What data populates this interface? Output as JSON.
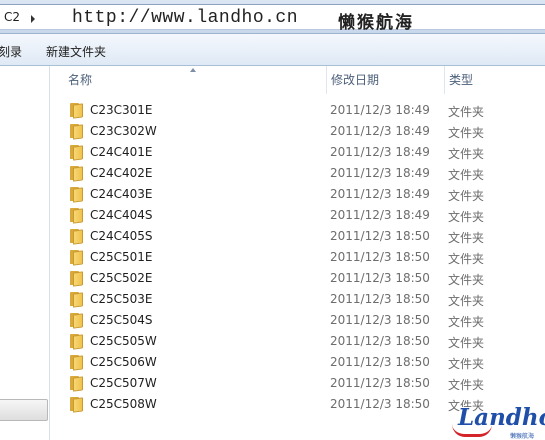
{
  "address": {
    "crumb": "C2",
    "watermark_url": "http://www.landho.cn",
    "watermark_name": "懒猴航海"
  },
  "toolbar": {
    "library_label": "刻录",
    "new_folder_label": "新建文件夹"
  },
  "columns": {
    "name": "名称",
    "date": "修改日期",
    "type": "类型"
  },
  "files": [
    {
      "name": "C23C301E",
      "date": "2011/12/3 18:49",
      "type": "文件夹"
    },
    {
      "name": "C23C302W",
      "date": "2011/12/3 18:49",
      "type": "文件夹"
    },
    {
      "name": "C24C401E",
      "date": "2011/12/3 18:49",
      "type": "文件夹"
    },
    {
      "name": "C24C402E",
      "date": "2011/12/3 18:49",
      "type": "文件夹"
    },
    {
      "name": "C24C403E",
      "date": "2011/12/3 18:49",
      "type": "文件夹"
    },
    {
      "name": "C24C404S",
      "date": "2011/12/3 18:49",
      "type": "文件夹"
    },
    {
      "name": "C24C405S",
      "date": "2011/12/3 18:50",
      "type": "文件夹"
    },
    {
      "name": "C25C501E",
      "date": "2011/12/3 18:50",
      "type": "文件夹"
    },
    {
      "name": "C25C502E",
      "date": "2011/12/3 18:50",
      "type": "文件夹"
    },
    {
      "name": "C25C503E",
      "date": "2011/12/3 18:50",
      "type": "文件夹"
    },
    {
      "name": "C25C504S",
      "date": "2011/12/3 18:50",
      "type": "文件夹"
    },
    {
      "name": "C25C505W",
      "date": "2011/12/3 18:50",
      "type": "文件夹"
    },
    {
      "name": "C25C506W",
      "date": "2011/12/3 18:50",
      "type": "文件夹"
    },
    {
      "name": "C25C507W",
      "date": "2011/12/3 18:50",
      "type": "文件夹"
    },
    {
      "name": "C25C508W",
      "date": "2011/12/3 18:50",
      "type": "文件夹"
    }
  ],
  "icons": {
    "folder": "folder-icon",
    "breadcrumb_arrow": "chevron-right-icon",
    "sort": "sort-up-icon"
  },
  "logo": {
    "text": "Landho",
    "sub": "懒猴航海"
  },
  "colors": {
    "header_text": "#4c607a",
    "meta_text": "#6d6d6d",
    "folder": "#f1c24c",
    "logo_blue": "#1f4fa8",
    "logo_red": "#d4242a"
  }
}
